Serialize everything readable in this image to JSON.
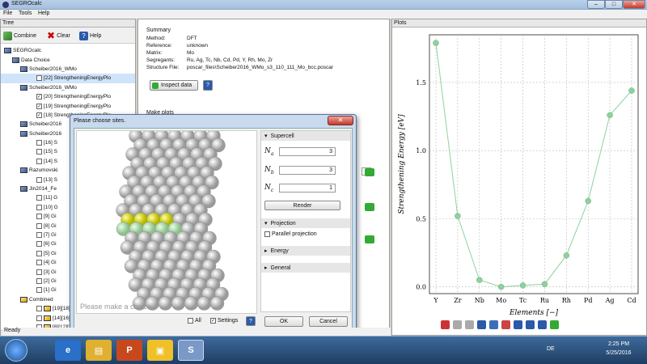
{
  "window": {
    "title": "SEGROcalc",
    "min": "–",
    "max": "□",
    "close": "✕"
  },
  "menu": [
    "File",
    "Tools",
    "Help"
  ],
  "tree": {
    "header": "Tree",
    "toolbar": {
      "combine": "Combine",
      "clear": "Clear",
      "help": "Help"
    },
    "items": [
      {
        "indent": 4,
        "label": "SEGROcalc",
        "icon": "app"
      },
      {
        "indent": 14,
        "label": "Data Choice",
        "icon": "folder"
      },
      {
        "indent": 24,
        "label": "Scheiber2016_WMo",
        "icon": "folder"
      },
      {
        "indent": 44,
        "label": "[22] StrengtheningEnergyPlo",
        "check": false,
        "selected": true
      },
      {
        "indent": 24,
        "label": "Scheiber2016_WMo",
        "icon": "folder"
      },
      {
        "indent": 44,
        "label": "[20] StrengtheningEnergyPlo",
        "check": true
      },
      {
        "indent": 44,
        "label": "[19] StrengtheningEnergyPlo",
        "check": true
      },
      {
        "indent": 44,
        "label": "[18] StrengtheningEnergyPlo",
        "check": true
      },
      {
        "indent": 24,
        "label": "Scheiber2016",
        "icon": "folder"
      },
      {
        "indent": 24,
        "label": "Scheiber2016",
        "icon": "folder"
      },
      {
        "indent": 44,
        "label": "[16] S",
        "check": false
      },
      {
        "indent": 44,
        "label": "[15] S",
        "check": false
      },
      {
        "indent": 44,
        "label": "[14] S",
        "check": false
      },
      {
        "indent": 24,
        "label": "Razumovski",
        "icon": "folder"
      },
      {
        "indent": 44,
        "label": "[13] S",
        "check": false
      },
      {
        "indent": 24,
        "label": "Jin2014_Fe",
        "icon": "folder"
      },
      {
        "indent": 44,
        "label": "[11] G",
        "check": false
      },
      {
        "indent": 44,
        "label": "[10] G",
        "check": false
      },
      {
        "indent": 44,
        "label": "[9] Gi",
        "check": false
      },
      {
        "indent": 44,
        "label": "[8] Gi",
        "check": false
      },
      {
        "indent": 44,
        "label": "[7] Gi",
        "check": false
      },
      {
        "indent": 44,
        "label": "[6] Gi",
        "check": false
      },
      {
        "indent": 44,
        "label": "[5] Gi",
        "check": false
      },
      {
        "indent": 44,
        "label": "[4] Gi",
        "check": false
      },
      {
        "indent": 44,
        "label": "[3] Gi",
        "check": false
      },
      {
        "indent": 44,
        "label": "[2] Gi",
        "check": false
      },
      {
        "indent": 44,
        "label": "[1] Gi",
        "check": false
      },
      {
        "indent": 24,
        "label": "Combined",
        "icon": "yfolder"
      },
      {
        "indent": 44,
        "label": "[19][18][2",
        "icon": "yfolder",
        "check": false
      },
      {
        "indent": 44,
        "label": "[14][16][1",
        "icon": "yfolder",
        "check": false
      },
      {
        "indent": 44,
        "label": "[8][12][3]",
        "icon": "yfolder",
        "check": false
      }
    ]
  },
  "summary": {
    "title": "Summary",
    "rows": [
      {
        "k": "Method:",
        "v": "DFT"
      },
      {
        "k": "Reference:",
        "v": "unknown"
      },
      {
        "k": "Matrix:",
        "v": "Mo"
      },
      {
        "k": "Segregants:",
        "v": "Ru, Ag, Tc, Nb, Cd, Pd, Y, Rh, Mo, Zr"
      },
      {
        "k": "Structure File:",
        "v": "poscar_files\\Scheiber2016_WMo_s3_110_111_Mo_bcc.poscar"
      }
    ],
    "inspect": "Inspect data",
    "help": "?",
    "make_plots": "Make plots"
  },
  "dialog": {
    "title": "Please choose sites.",
    "close": "✕",
    "viewer_text": "Please make a choice",
    "supercell": "Supercell",
    "na": "N",
    "na_sub": "a",
    "nb_sub": "b",
    "nc_sub": "c",
    "na_val": "3",
    "nb_val": "3",
    "nc_val": "1",
    "render": "Render",
    "projection": "Projection",
    "parallel": "Parallel projection",
    "energy": "Energy",
    "general": "General",
    "all": "All",
    "settings": "Settings",
    "help": "?",
    "ok": "OK",
    "cancel": "Cancel"
  },
  "plots": {
    "header": "Plots",
    "toolbar_icons": [
      "home-icon",
      "back-icon",
      "forward-icon",
      "pan-icon",
      "zoom-icon",
      "subplots-icon",
      "save-icon",
      "settings-icon",
      "help-icon",
      "info-icon"
    ]
  },
  "chart_data": {
    "type": "line",
    "categories": [
      "Y",
      "Zr",
      "Nb",
      "Mo",
      "Tc",
      "Ru",
      "Rh",
      "Pd",
      "Ag",
      "Cd"
    ],
    "values": [
      1.79,
      0.52,
      0.05,
      0.0,
      0.01,
      0.02,
      0.23,
      0.63,
      1.26,
      1.44
    ],
    "xlabel": "Elements [−]",
    "ylabel": "Strengthening Energy [eV]",
    "ylim": [
      -0.05,
      1.85
    ],
    "yticks": [
      "0.0",
      "0.5",
      "1.0",
      "1.5"
    ],
    "grid": true,
    "color": "#8fd19e"
  },
  "status": "Ready",
  "taskbar": {
    "lang": "DE",
    "time": "2:25 PM",
    "date": "5/25/2016"
  }
}
